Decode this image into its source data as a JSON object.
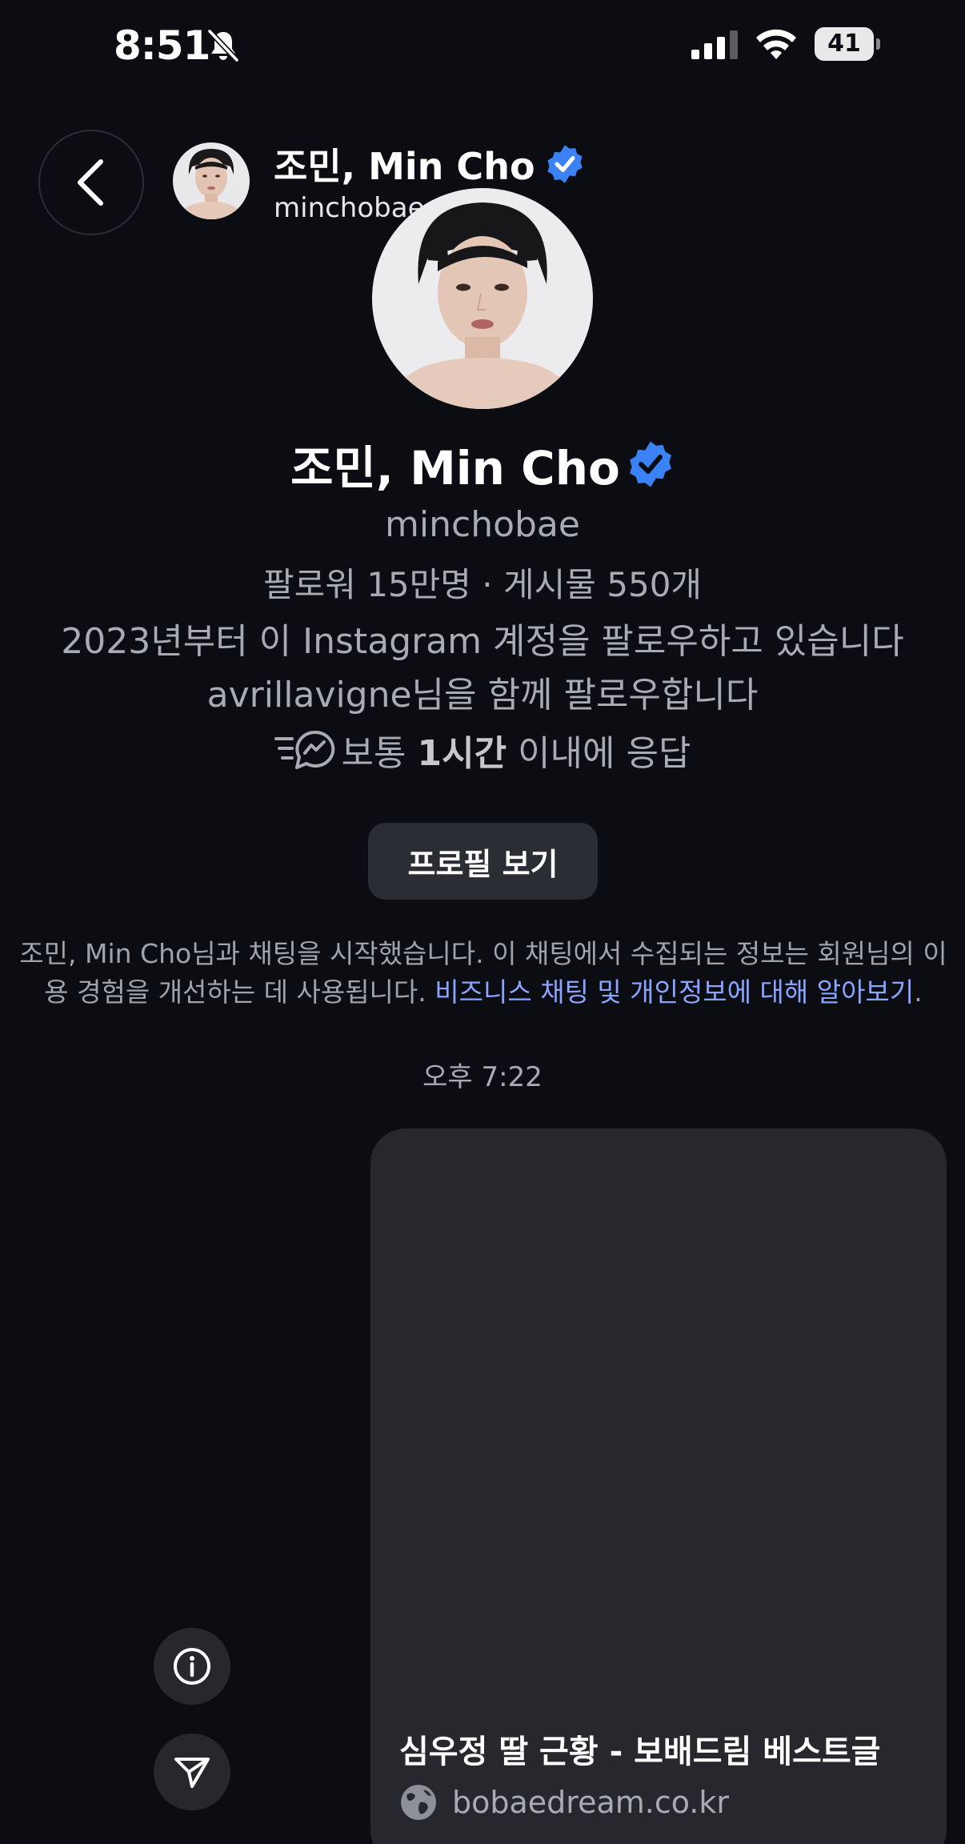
{
  "status_bar": {
    "time": "8:51",
    "battery": "41",
    "icons": [
      "bell-slash-icon",
      "cellular-signal-icon",
      "wifi-icon",
      "battery-icon"
    ]
  },
  "header": {
    "name": "조민, Min Cho",
    "username": "minchobae",
    "icons": [
      "back-chevron-icon",
      "verified-badge-icon"
    ]
  },
  "profile": {
    "name": "조민, Min Cho",
    "username": "minchobae",
    "stats": "팔로워 15만명 · 게시물 550개",
    "since": "2023년부터 이 Instagram 계정을 팔로우하고 있습니다",
    "mutual": "avrillavigne님을 함께 팔로우합니다",
    "response_prefix": "보통 ",
    "response_bold": "1시간",
    "response_suffix": " 이내에 응답",
    "view_profile_label": "프로필 보기"
  },
  "info": {
    "text": "조민, Min Cho님과 채팅을 시작했습니다. 이 채팅에서 수집되는 정보는 회원님의 이용 경험을 개선하는 데 사용됩니다. ",
    "link": "비즈니스 채팅 및 개인정보에 대해 알아보기",
    "end": "."
  },
  "chat": {
    "timestamp": "오후 7:22",
    "card_title": "심우정 딸 근황 - 보배드림 베스트글",
    "card_domain": "bobaedream.co.kr"
  },
  "colors": {
    "background": "#0b0d12",
    "card": "#26282d",
    "link": "#8aa4ff",
    "verified": "#3b82f6",
    "secondary_text": "#a8abb2"
  }
}
